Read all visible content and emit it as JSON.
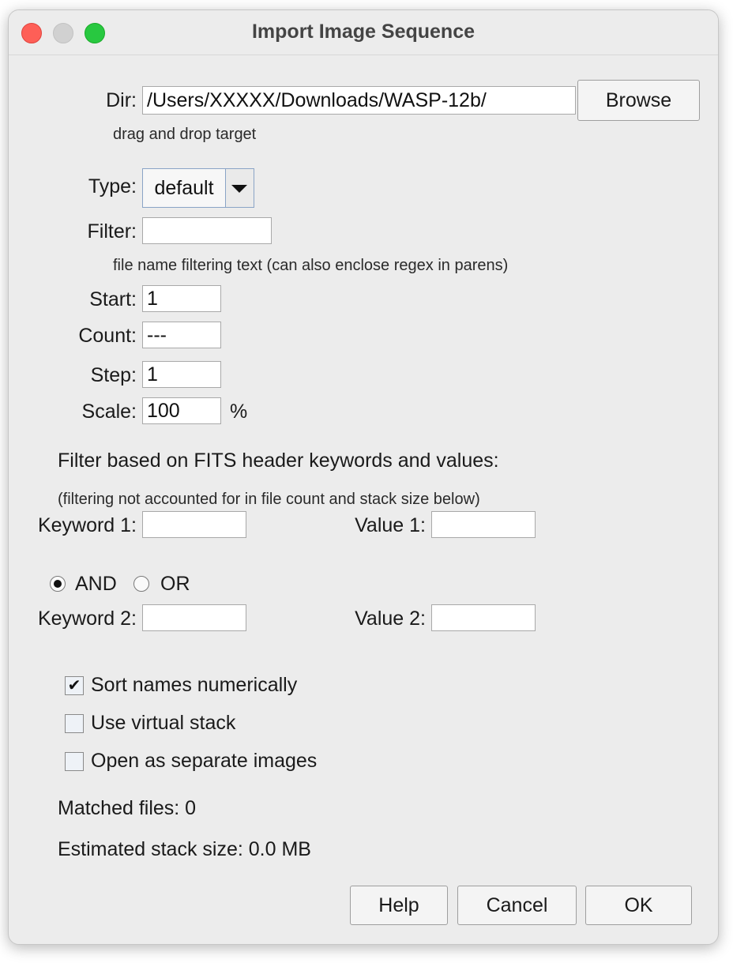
{
  "window": {
    "title": "Import Image Sequence"
  },
  "dir": {
    "label": "Dir:",
    "value": "/Users/XXXXX/Downloads/WASP-12b/",
    "browse_label": "Browse",
    "hint": "drag and drop target"
  },
  "type": {
    "label": "Type:",
    "value": "default"
  },
  "filter": {
    "label": "Filter:",
    "value": "",
    "hint": "file name filtering text (can also enclose regex in parens)"
  },
  "start": {
    "label": "Start:",
    "value": "1"
  },
  "count": {
    "label": "Count:",
    "value": "---"
  },
  "step": {
    "label": "Step:",
    "value": "1"
  },
  "scale": {
    "label": "Scale:",
    "value": "100",
    "unit": "%"
  },
  "fits": {
    "heading": "Filter based on FITS header keywords and values:",
    "note": "(filtering not accounted for in file count and stack size below)",
    "keyword1_label": "Keyword 1:",
    "keyword1_value": "",
    "value1_label": "Value 1:",
    "value1_value": "",
    "and_label": "AND",
    "or_label": "OR",
    "selected": "AND",
    "keyword2_label": "Keyword 2:",
    "keyword2_value": "",
    "value2_label": "Value 2:",
    "value2_value": ""
  },
  "options": {
    "sort_label": "Sort names numerically",
    "sort_checked": true,
    "virtual_label": "Use virtual stack",
    "virtual_checked": false,
    "separate_label": "Open as separate images",
    "separate_checked": false,
    "check_glyph": "✔"
  },
  "status": {
    "matched": "Matched files: 0",
    "stack_size": "Estimated stack size: 0.0 MB"
  },
  "buttons": {
    "help": "Help",
    "cancel": "Cancel",
    "ok": "OK"
  }
}
